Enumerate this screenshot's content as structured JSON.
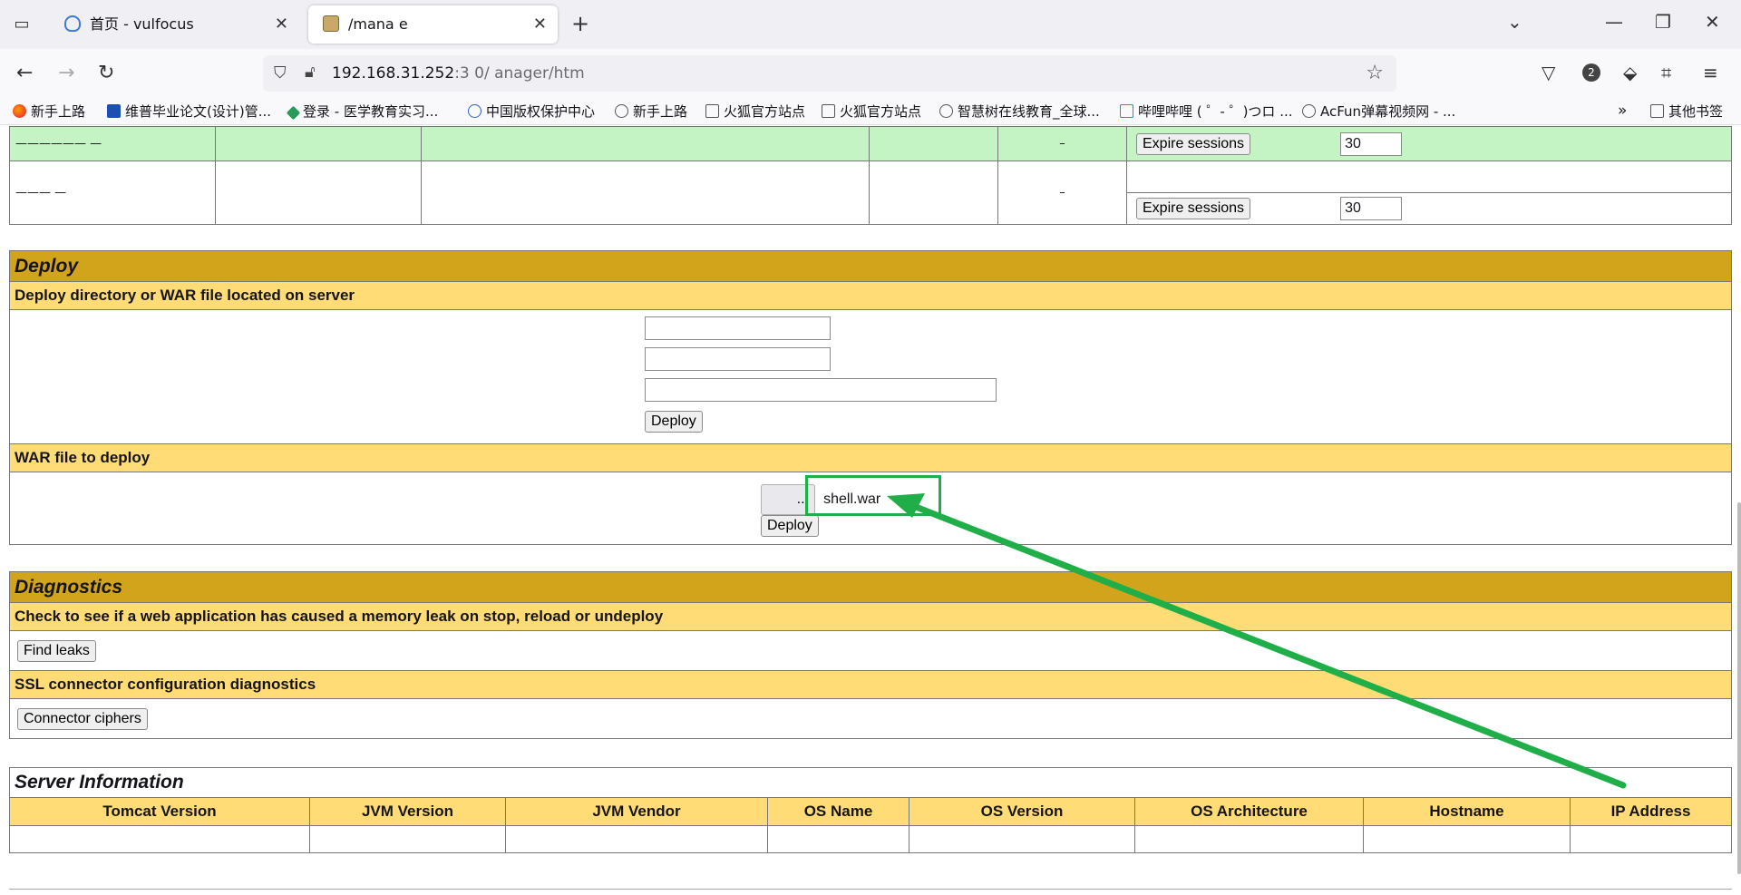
{
  "browser": {
    "tabs": [
      {
        "title": "首页 - vulfocus"
      },
      {
        "title": "/mana  e"
      }
    ],
    "url_main": "192.168.31.252",
    "url_dim": ":3       0/   anager/htm",
    "extensions_badge": "2"
  },
  "bookmarks": [
    "新手上路",
    "维普毕业论文(设计)管...",
    "登录 - 医学教育实习...",
    "中国版权保护中心",
    "新手上路",
    "火狐官方站点",
    "火狐官方站点",
    "智慧树在线教育_全球...",
    "哔哩哔哩 ( ゜- ゜)つロ ...",
    "AcFun弹幕视频网 - ...",
    "其他书签"
  ],
  "sessions": {
    "rows": [
      {
        "path": "——————  —",
        "dash": "–",
        "expire_label": "Expire sessions",
        "idle": "30"
      },
      {
        "path": "———  —",
        "dash": "–",
        "expire_label": "Expire sessions",
        "idle": "30"
      }
    ]
  },
  "deploy": {
    "title": "Deploy",
    "server_subtitle": "Deploy directory or WAR file located on server",
    "server_deploy_label": "Deploy",
    "war_subtitle": "WAR file to deploy",
    "browse_label": "...",
    "file_name": "shell.war",
    "war_deploy_label": "Deploy"
  },
  "diagnostics": {
    "title": "Diagnostics",
    "leak_subtitle": "Check to see if a web application has caused a memory leak on stop, reload or undeploy",
    "find_leaks_label": "Find leaks",
    "ssl_subtitle": "SSL connector configuration diagnostics",
    "ciphers_label": "Connector ciphers"
  },
  "server_info": {
    "title": "Server Information",
    "columns": [
      "Tomcat Version",
      "JVM Version",
      "JVM Vendor",
      "OS Name",
      "OS Version",
      "OS Architecture",
      "Hostname",
      "IP Address"
    ]
  },
  "annotation": {
    "color": "#1fae47"
  }
}
